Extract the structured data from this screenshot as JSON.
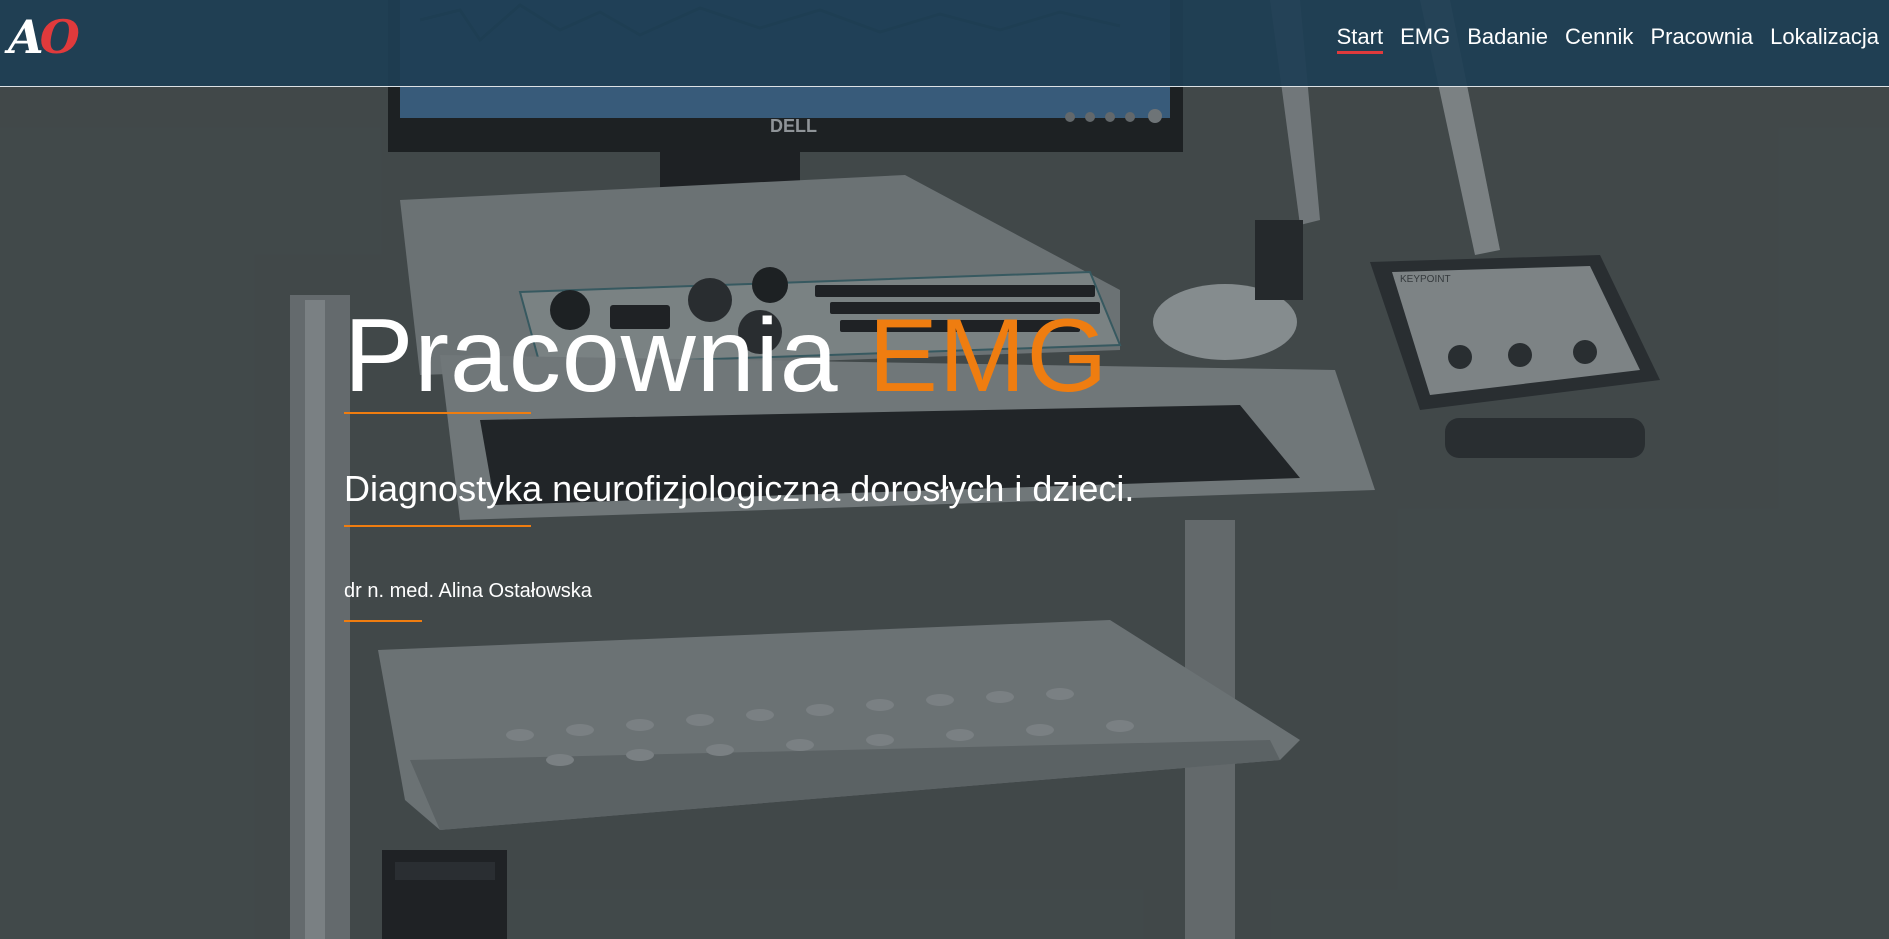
{
  "brand": {
    "logo_first": "A",
    "logo_second": "O",
    "logo_accent": "#e03a3c"
  },
  "nav": {
    "items": [
      {
        "label": "Start",
        "active": true
      },
      {
        "label": "EMG"
      },
      {
        "label": "Badanie"
      },
      {
        "label": "Cennik"
      },
      {
        "label": "Pracownia"
      },
      {
        "label": "Lokalizacja"
      }
    ]
  },
  "hero": {
    "title_main": "Pracownia",
    "title_accent": "EMG",
    "subtitle": "Diagnostyka neurofizjologiczna dorosłych i dzieci.",
    "author": "dr n. med. Alina Ostałowska",
    "accent_color": "#ef7d10",
    "background": "emg-workstation-photo",
    "monitor_brand": "DELL",
    "device_label": "KEYPOINT"
  }
}
